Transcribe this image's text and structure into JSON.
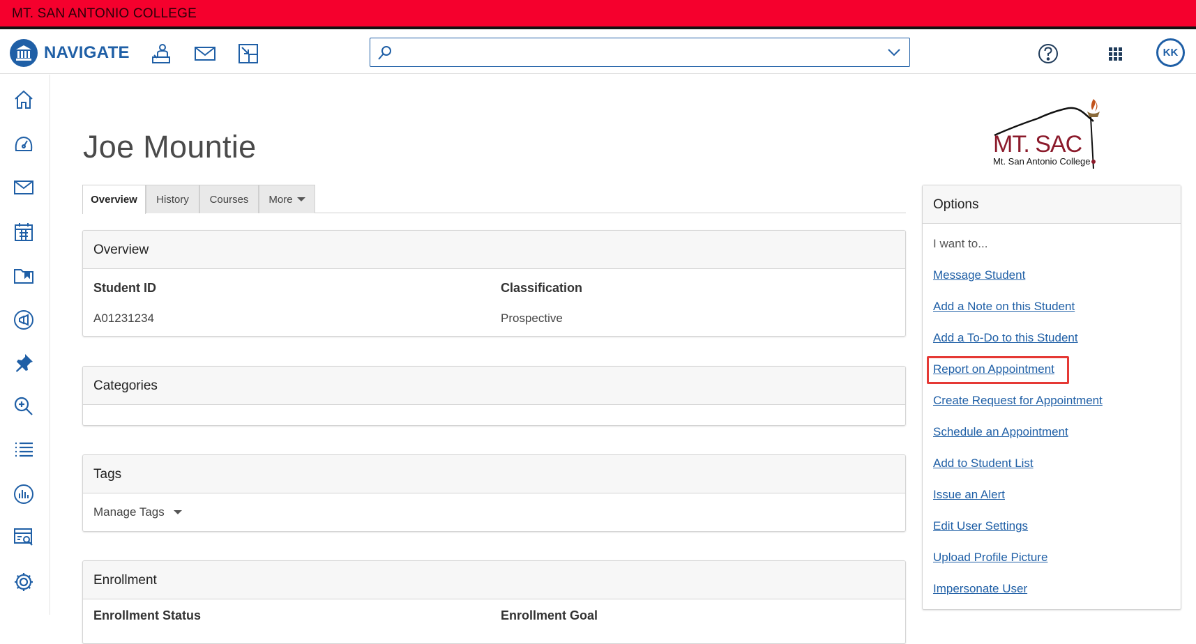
{
  "banner": {
    "text": "MT. SAN ANTONIO COLLEGE"
  },
  "header": {
    "brand": "NAVIGATE",
    "search": {
      "value": "",
      "placeholder": ""
    },
    "user_initials": "KK",
    "accent_color": "#1f5fa6"
  },
  "student": {
    "name": "Joe Mountie"
  },
  "school_logo": {
    "name": "MT. SAC",
    "subtitle": "Mt. San Antonio College",
    "color": "#8b1a2b"
  },
  "tabs": [
    {
      "label": "Overview"
    },
    {
      "label": "History"
    },
    {
      "label": "Courses"
    },
    {
      "label": "More"
    }
  ],
  "overview": {
    "title": "Overview",
    "fields": [
      {
        "label": "Student ID",
        "value": "A01231234"
      },
      {
        "label": "Classification",
        "value": "Prospective"
      }
    ]
  },
  "categories": {
    "title": "Categories"
  },
  "tags": {
    "title": "Tags",
    "manage_label": "Manage Tags"
  },
  "enrollment": {
    "title": "Enrollment",
    "fields": [
      {
        "label": "Enrollment Status"
      },
      {
        "label": "Enrollment Goal"
      }
    ]
  },
  "options": {
    "title": "Options",
    "prompt": "I want to...",
    "links": [
      "Message Student",
      "Add a Note on this Student",
      "Add a To-Do to this Student",
      "Report on Appointment",
      "Create Request for Appointment",
      "Schedule an Appointment",
      "Add to Student List",
      "Issue an Alert",
      "Edit User Settings",
      "Upload Profile Picture",
      "Impersonate User"
    ],
    "highlighted_link": "Report on Appointment",
    "highlight_color": "#e53935"
  },
  "sidebar_icons": [
    "home-icon",
    "dashboard-icon",
    "mail-icon",
    "calendar-icon",
    "folder-icon",
    "campaign-icon",
    "pin-icon",
    "search-zoom-icon",
    "list-icon",
    "reports-icon",
    "analytics-icon",
    "settings-icon"
  ]
}
